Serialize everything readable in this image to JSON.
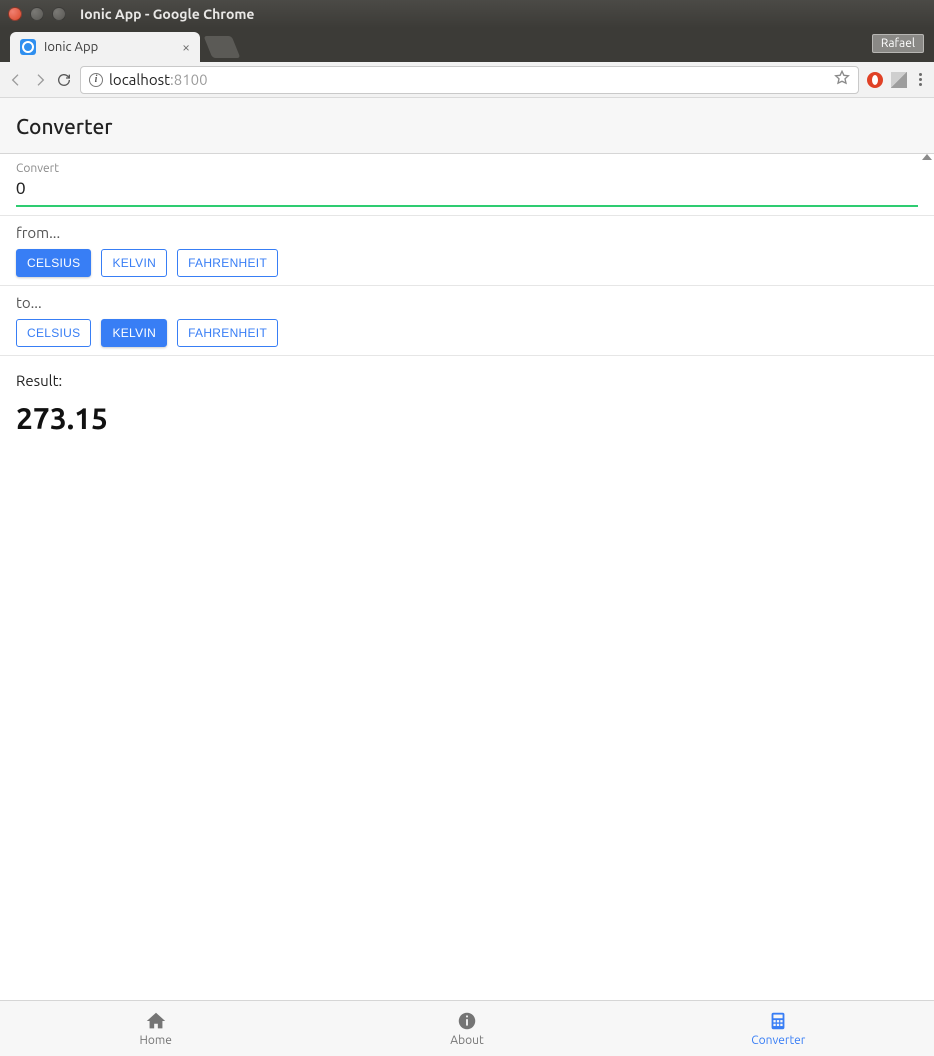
{
  "window": {
    "title": "Ionic App - Google Chrome",
    "profile": "Rafael"
  },
  "browser": {
    "tab_title": "Ionic App",
    "url_host": "localhost",
    "url_port": ":8100"
  },
  "app": {
    "header_title": "Converter",
    "convert": {
      "label": "Convert",
      "value": "0"
    },
    "from": {
      "label": "from...",
      "options": [
        "CELSIUS",
        "KELVIN",
        "FAHRENHEIT"
      ],
      "selected": "CELSIUS"
    },
    "to": {
      "label": "to...",
      "options": [
        "CELSIUS",
        "KELVIN",
        "FAHRENHEIT"
      ],
      "selected": "KELVIN"
    },
    "result": {
      "label": "Result:",
      "value": "273.15"
    },
    "tabs": [
      {
        "id": "home",
        "label": "Home",
        "active": false
      },
      {
        "id": "about",
        "label": "About",
        "active": false
      },
      {
        "id": "converter",
        "label": "Converter",
        "active": true
      }
    ]
  }
}
